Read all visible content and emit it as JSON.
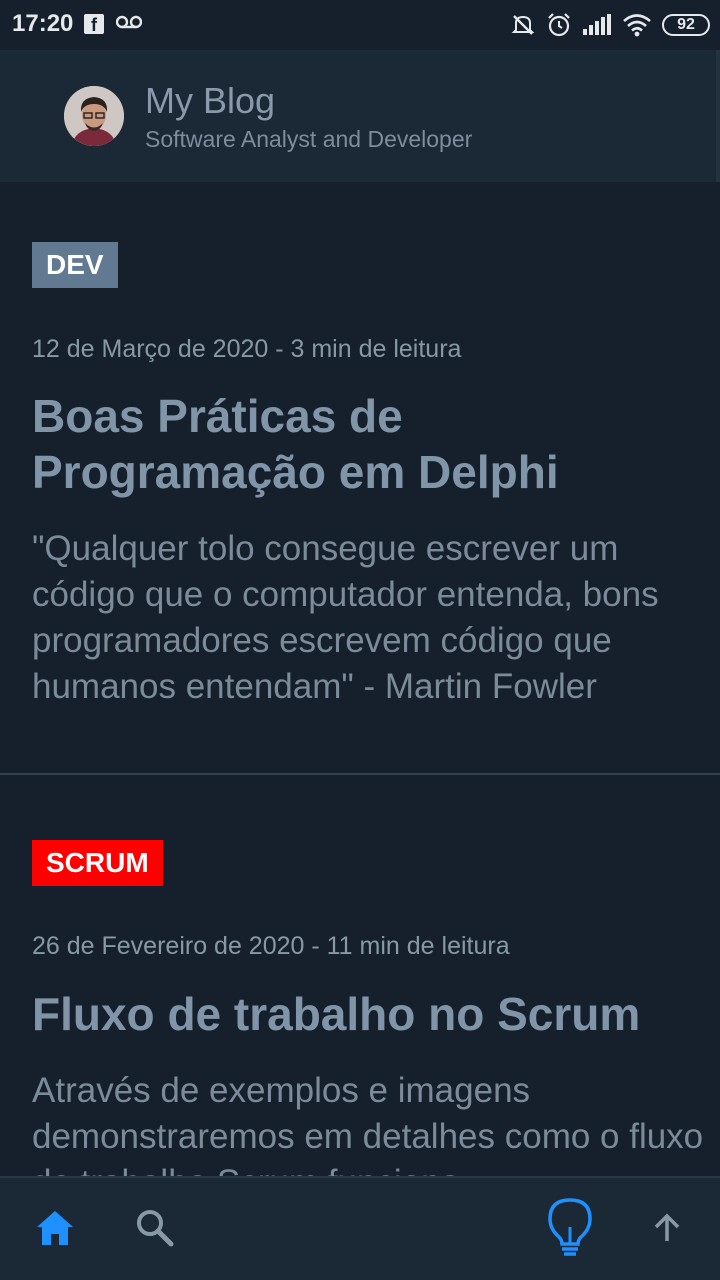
{
  "statusbar": {
    "time": "17:20",
    "facebook_glyph": "f",
    "battery": "92",
    "icons": [
      "facebook-icon",
      "voicemail-icon",
      "mute-icon",
      "alarm-icon",
      "signal-icon",
      "wifi-icon",
      "battery-icon"
    ]
  },
  "header": {
    "title": "My Blog",
    "subtitle": "Software Analyst and Developer"
  },
  "posts": [
    {
      "tag": "DEV",
      "tag_color": "#627a91",
      "meta": "12 de Março de 2020 - 3 min de leitura",
      "title": "Boas Práticas de Programação em Delphi",
      "excerpt": "\"Qualquer tolo consegue escrever um código que o computador entenda, bons programadores escrevem código que humanos entendam\" - Martin Fowler"
    },
    {
      "tag": "SCRUM",
      "tag_color": "#ff0000",
      "meta": "26 de Fevereiro de 2020 - 11 min de leitura",
      "title": "Fluxo de trabalho no Scrum",
      "excerpt": "Através de exemplos e imagens demonstraremos em detalhes como o fluxo de trabalho Scrum funciona"
    }
  ],
  "bottom_nav": {
    "items": [
      "home-icon",
      "search-icon",
      "lightbulb-icon",
      "arrow-up-icon"
    ],
    "active_color": "#1e90ff",
    "inactive_color": "#8899a6"
  }
}
